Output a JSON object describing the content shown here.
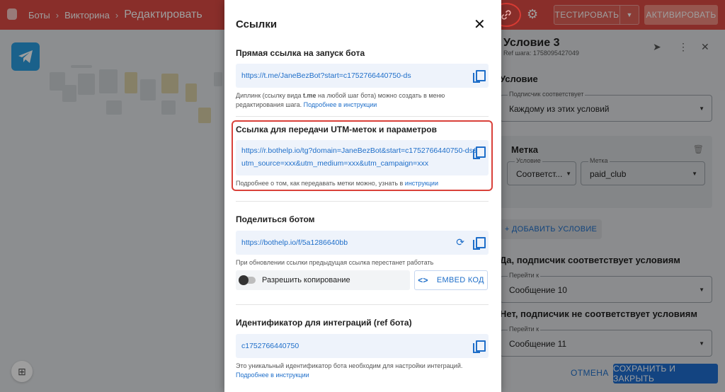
{
  "header": {
    "breadcrumbs": [
      "Боты",
      "Викторина",
      "Редактировать"
    ],
    "test_label": "ТЕСТИРОВАТЬ",
    "activate_label": "АКТИВИРОВАТЬ"
  },
  "panel": {
    "title": "Условие 3",
    "ref": "Ref шага: 1758095427049",
    "condition_heading": "Условие",
    "subscriber_label": "Подписчик соответствует",
    "subscriber_value": "Каждому из этих условий",
    "tag_heading": "Метка",
    "cond_label": "Условие",
    "cond_value": "Соответст...",
    "tag_label": "Метка",
    "tag_value": "paid_club",
    "add_condition": "+ ДОБАВИТЬ УСЛОВИЕ",
    "yes_heading": "Да, подписчик соответствует условиям",
    "goto_label_yes": "Перейти к",
    "goto_value_yes": "Сообщение 10",
    "no_heading": "Нет, подписчик не соответствует условиям",
    "goto_label_no": "Перейти к",
    "goto_value_no": "Сообщение 11",
    "cancel_label": "ОТМЕНА",
    "save_label": "СОХРАНИТЬ И ЗАКРЫТЬ"
  },
  "modal": {
    "title": "Ссылки",
    "direct": {
      "title": "Прямая ссылка на запуск бота",
      "url": "https://t.me/JaneBezBot?start=c1752766440750-ds",
      "hint_a": "Диплинк (ссылку вида ",
      "hint_b": "t.me",
      "hint_c": " на любой шаг бота) можно создать в меню редактирования шага. ",
      "hint_link": "Подробнее в инструкции"
    },
    "utm": {
      "title": "Ссылка для передачи UTM-меток и параметров",
      "url_line1": "https://r.bothelp.io/tg?domain=JaneBezBot&start=c1752766440750-ds&",
      "url_line2": "utm_source=xxx&utm_medium=xxx&utm_campaign=xxx",
      "hint": "Подробнее о том, как передавать метки можно, узнать в ",
      "hint_link": "инструкции"
    },
    "share": {
      "title": "Поделиться ботом",
      "url": "https://bothelp.io/f/5a1286640bb",
      "hint": "При обновлении ссылки предыдущая ссылка перестанет работать",
      "toggle_label": "Разрешить копирование",
      "embed_icon": "<>",
      "embed_label": "EMBED КОД"
    },
    "integration": {
      "title": "Идентификатор для интеграций (ref бота)",
      "value": "c1752766440750",
      "hint": "Это уникальный идентификатор бота необходим для настройки интеграций.",
      "hint_link": "Подробнее в инструкции"
    }
  },
  "colors": {
    "header": "#dd4b44",
    "link": "#1e6ec9",
    "highlight": "#d9413a",
    "primary_button": "#1f6fd0"
  },
  "icons": [
    "bot-icon",
    "link-icon",
    "gear-icon",
    "telegram-icon",
    "send-icon",
    "more-icon",
    "close-icon",
    "trash-icon",
    "copy-icon",
    "refresh-icon",
    "grid-icon"
  ]
}
